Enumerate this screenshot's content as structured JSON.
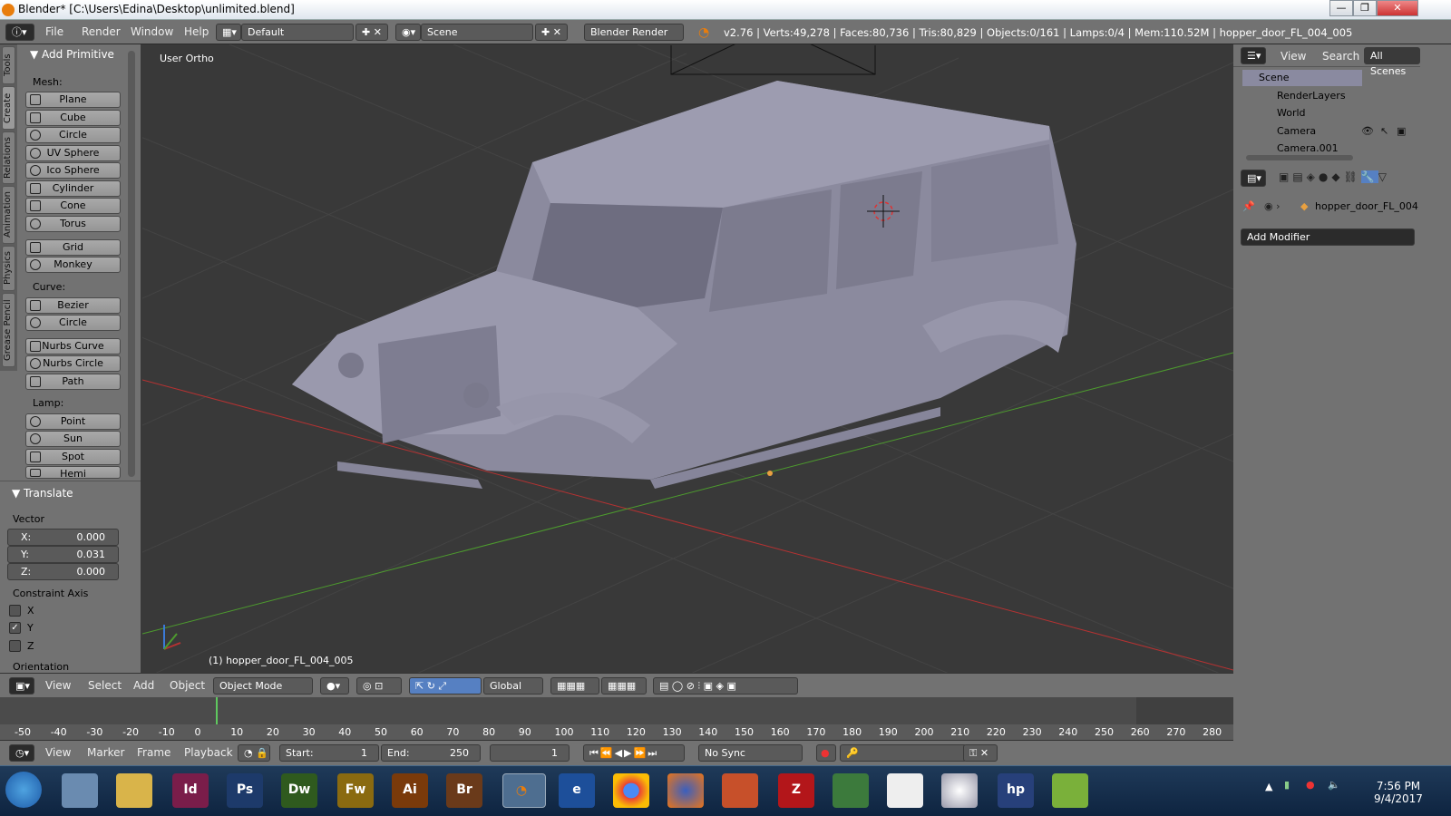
{
  "window": {
    "title": "Blender* [C:\\Users\\Edina\\Desktop\\unlimited.blend]",
    "controls": [
      "—",
      "❐",
      "✕"
    ]
  },
  "info_bar": {
    "menus": [
      "File",
      "Render",
      "Window",
      "Help"
    ],
    "layout": "Default",
    "scene": "Scene",
    "engine": "Blender Render",
    "stats": "v2.76 | Verts:49,278 | Faces:80,736 | Tris:80,829 | Objects:0/161 | Lamps:0/4 | Mem:110.52M | hopper_door_FL_004_005"
  },
  "tool_tabs": [
    "Tools",
    "Create",
    "Relations",
    "Animation",
    "Physics",
    "Grease Pencil"
  ],
  "tool_shelf": {
    "header": "Add Primitive",
    "mesh_label": "Mesh:",
    "mesh": [
      "Plane",
      "Cube",
      "Circle",
      "UV Sphere",
      "Ico Sphere",
      "Cylinder",
      "Cone",
      "Torus",
      "Grid",
      "Monkey"
    ],
    "curve_label": "Curve:",
    "curve": [
      "Bezier",
      "Circle",
      "Nurbs Curve",
      "Nurbs Circle",
      "Path"
    ],
    "lamp_label": "Lamp:",
    "lamp": [
      "Point",
      "Sun",
      "Spot",
      "Hemi"
    ]
  },
  "operator_panel": {
    "header": "Translate",
    "vector_label": "Vector",
    "x_key": "X:",
    "x": "0.000",
    "y_key": "Y:",
    "y": "0.031",
    "z_key": "Z:",
    "z": "0.000",
    "constraint_label": "Constraint Axis",
    "axes": [
      {
        "label": "X",
        "checked": false
      },
      {
        "label": "Y",
        "checked": true
      },
      {
        "label": "Z",
        "checked": false
      }
    ],
    "orientation_label": "Orientation"
  },
  "viewport": {
    "view_label": "User Ortho",
    "object_label": "(1) hopper_door_FL_004_005"
  },
  "view3d_header": {
    "menus": [
      "View",
      "Select",
      "Add",
      "Object"
    ],
    "mode": "Object Mode",
    "orientation": "Global"
  },
  "timeline": {
    "ticks": [
      "-50",
      "-40",
      "-30",
      "-20",
      "-10",
      "0",
      "10",
      "20",
      "30",
      "40",
      "50",
      "60",
      "70",
      "80",
      "90",
      "100",
      "110",
      "120",
      "130",
      "140",
      "150",
      "160",
      "170",
      "180",
      "190",
      "200",
      "210",
      "220",
      "230",
      "240",
      "250",
      "260",
      "270",
      "280"
    ],
    "menus": [
      "View",
      "Marker",
      "Frame",
      "Playback"
    ],
    "start_label": "Start:",
    "start": "1",
    "end_label": "End:",
    "end": "250",
    "current": "1",
    "sync": "No Sync",
    "current_frame_value": 0
  },
  "outliner": {
    "menus": [
      "View",
      "Search"
    ],
    "filter": "All Scenes",
    "items": [
      "Scene",
      "RenderLayers",
      "World",
      "Camera",
      "Camera.001"
    ]
  },
  "properties": {
    "object_name": "hopper_door_FL_004",
    "add_modifier": "Add Modifier"
  },
  "taskbar": {
    "apps": [
      "Id",
      "Ps",
      "Dw",
      "Fw",
      "Ai",
      "Br"
    ],
    "time": "7:56 PM",
    "date": "9/4/2017"
  },
  "colors": {
    "viewport_bg": "#393939",
    "panel_bg": "#727272",
    "button": "#9e9e9e",
    "accent_blue": "#5680c2",
    "x_axis": "#b53232",
    "y_axis": "#4d9b2e",
    "blender_orange": "#e87d0d"
  }
}
